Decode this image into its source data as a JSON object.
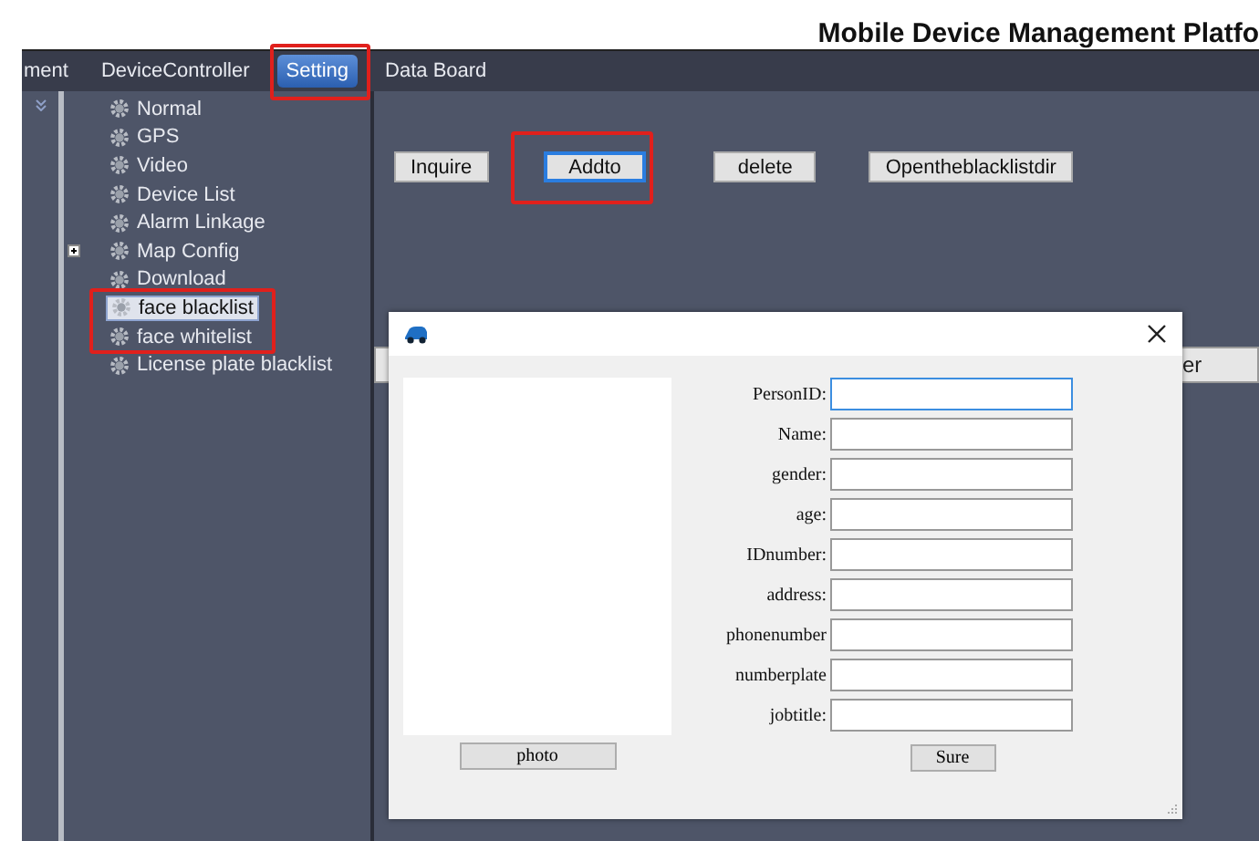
{
  "title": "Mobile Device Management Platfo",
  "menu": [
    {
      "label": "ment",
      "selected": false
    },
    {
      "label": "DeviceController",
      "selected": false
    },
    {
      "label": "Setting",
      "selected": true
    },
    {
      "label": "Data Board",
      "selected": false
    }
  ],
  "tree": [
    {
      "label": "Normal",
      "kind": "leaf",
      "selected": false
    },
    {
      "label": "GPS",
      "kind": "leaf",
      "selected": false
    },
    {
      "label": "Video",
      "kind": "leaf",
      "selected": false
    },
    {
      "label": "Device List",
      "kind": "leaf",
      "selected": false
    },
    {
      "label": "Alarm Linkage",
      "kind": "leaf",
      "selected": false
    },
    {
      "label": "Map Config",
      "kind": "folder",
      "expanded": false,
      "selected": false
    },
    {
      "label": "Download",
      "kind": "leaf",
      "selected": false
    },
    {
      "label": "face blacklist",
      "kind": "leaf",
      "selected": true
    },
    {
      "label": "face whitelist",
      "kind": "leaf",
      "selected": false
    },
    {
      "label": "License plate blacklist",
      "kind": "leaf",
      "selected": false
    }
  ],
  "toolbar": [
    {
      "label": "Inquire",
      "focused": false
    },
    {
      "label": "Addto",
      "focused": true
    },
    {
      "label": "delete",
      "focused": false
    },
    {
      "label": "Opentheblacklistdir",
      "focused": false
    }
  ],
  "table": {
    "columns": [
      "er"
    ]
  },
  "dialog": {
    "fields": [
      {
        "label": "PersonID:",
        "focused": true
      },
      {
        "label": "Name:",
        "focused": false
      },
      {
        "label": "gender:",
        "focused": false
      },
      {
        "label": "age:",
        "focused": false
      },
      {
        "label": "IDnumber:",
        "focused": false
      },
      {
        "label": "address:",
        "focused": false
      },
      {
        "label": "phonenumber",
        "focused": false
      },
      {
        "label": "numberplate",
        "focused": false
      },
      {
        "label": "jobtitle:",
        "focused": false
      }
    ],
    "photo_button": "photo",
    "submit_button": "Sure"
  }
}
